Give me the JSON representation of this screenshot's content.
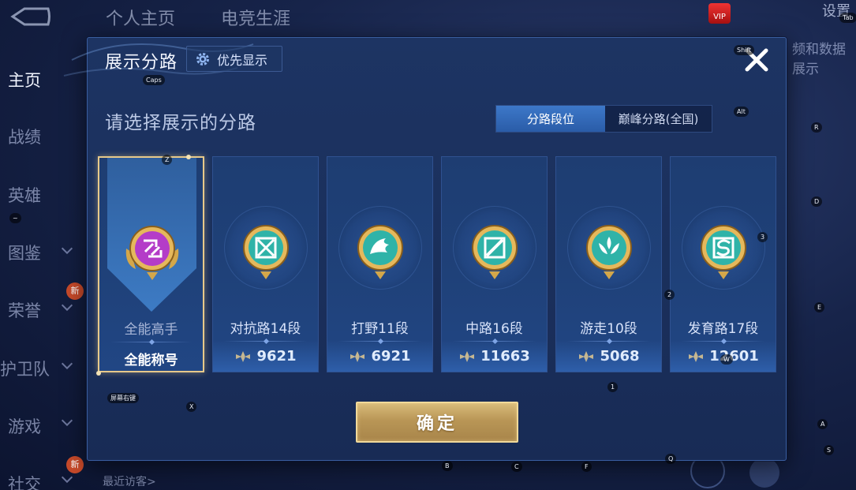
{
  "background": {
    "top_tabs": [
      "个人主页",
      "电竞生涯"
    ],
    "vip_label": "VIP",
    "settings_label": "设置",
    "side_nav": [
      {
        "label": "主页",
        "active": true,
        "chevron": false,
        "badge": ""
      },
      {
        "label": "战绩",
        "active": false,
        "chevron": false,
        "badge": ""
      },
      {
        "label": "英雄",
        "active": false,
        "chevron": false,
        "badge": ""
      },
      {
        "label": "图鉴",
        "active": false,
        "chevron": true,
        "badge": ""
      },
      {
        "label": "荣誉",
        "active": false,
        "chevron": true,
        "badge": "新"
      },
      {
        "label": "护卫队",
        "active": false,
        "chevron": true,
        "badge": ""
      },
      {
        "label": "游戏",
        "active": false,
        "chevron": true,
        "badge": ""
      },
      {
        "label": "社交",
        "active": false,
        "chevron": true,
        "badge": "新"
      }
    ],
    "right_text": "频和数据展示",
    "recent_visitors": "最近访客>"
  },
  "key_hints": [
    "Caps",
    "Shift",
    "Tab",
    "Alt",
    "R",
    "Z",
    "~",
    "D",
    "3",
    "2",
    "E",
    "1",
    "X",
    "屏幕右键",
    "W",
    "A",
    "S",
    "B",
    "C",
    "F",
    "Q"
  ],
  "modal": {
    "title": "展示分路",
    "priority_button": "优先显示",
    "subtitle": "请选择展示的分路",
    "tabs": [
      {
        "label": "分路段位",
        "active": true
      },
      {
        "label": "巅峰分路(全国)",
        "active": false
      }
    ],
    "cards": [
      {
        "lane": "全能高手",
        "value": "全能称号",
        "selected": true,
        "emblem": "all-round-emblem-icon",
        "color": "#b43cc8"
      },
      {
        "lane": "对抗路14段",
        "value": "9621",
        "selected": false,
        "emblem": "clash-lane-emblem-icon",
        "color": "#2fb3a8"
      },
      {
        "lane": "打野11段",
        "value": "6921",
        "selected": false,
        "emblem": "jungle-emblem-icon",
        "color": "#2fb3a8"
      },
      {
        "lane": "中路16段",
        "value": "11663",
        "selected": false,
        "emblem": "mid-lane-emblem-icon",
        "color": "#2fb3a8"
      },
      {
        "lane": "游走10段",
        "value": "5068",
        "selected": false,
        "emblem": "roam-emblem-icon",
        "color": "#2fb3a8"
      },
      {
        "lane": "发育路17段",
        "value": "12601",
        "selected": false,
        "emblem": "farm-lane-emblem-icon",
        "color": "#2fb3a8"
      }
    ],
    "confirm_button": "确定"
  },
  "colors": {
    "accent_gold": "#e7c98a",
    "tab_active": "#3d78c9",
    "emblem_teal": "#2fb3a8",
    "emblem_purple": "#b43cc8"
  }
}
